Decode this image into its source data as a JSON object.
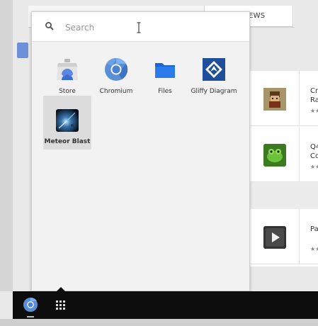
{
  "background": {
    "tab_reviews_label": "EWS",
    "rows": [
      {
        "title": "Cr\nRa",
        "stars": "★★"
      },
      {
        "title": "Q4\nCo",
        "stars": "★★"
      },
      {
        "title": "Pa",
        "stars": "★★"
      }
    ]
  },
  "launcher": {
    "search_placeholder": "Search",
    "apps": [
      {
        "name": "Store",
        "icon": "store-icon"
      },
      {
        "name": "Chromium",
        "icon": "chromium-icon"
      },
      {
        "name": "Files",
        "icon": "folder-icon"
      },
      {
        "name": "Gliffy Diagram",
        "icon": "gliffy-icon"
      },
      {
        "name": "Meteor Blast",
        "icon": "meteor-blast-icon",
        "selected": true
      }
    ]
  },
  "shelf": {
    "items": [
      "chromium-icon",
      "app-launcher-icon"
    ]
  }
}
